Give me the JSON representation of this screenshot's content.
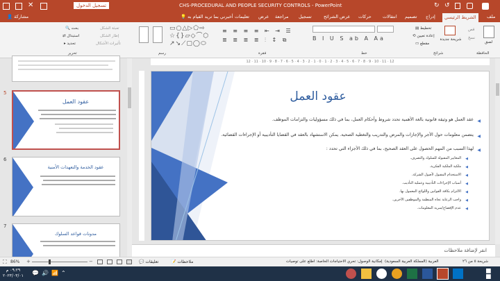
{
  "window": {
    "title": "CHS-PROCEDURAL AND PEOPLE SECURITY CONTROLS  -  PowerPoint",
    "signin": "تسجيل الدخول",
    "share": "مشاركة",
    "tell_me": "أخبرني بما تريد القيام به"
  },
  "tabs": [
    "ملف",
    "الشريط الرئيسي",
    "إدراج",
    "تصميم",
    "انتقالات",
    "حركات",
    "عرض الشرائح",
    "تسجيل",
    "مراجعة",
    "عرض",
    "تعليمات"
  ],
  "ribbon": {
    "paste": "لصق",
    "cut": "قص",
    "copy": "نسخ",
    "new_slide": "شريحة جديدة",
    "layout": "تخطيط",
    "reset": "إعادة تعيين",
    "section": "مقطع",
    "groups": {
      "clipboard": "الحافظة",
      "slides": "شرائح",
      "font": "خط",
      "paragraph": "فقرة",
      "drawing": "رسم",
      "editing": "تحرير"
    },
    "find": "بحث",
    "replace": "استبدال",
    "select": "تحديد",
    "fill": "تعبئة الشكل",
    "outline": "إطار الشكل",
    "effects": "تأثيرات الأشكال"
  },
  "thumbs": [
    {
      "num": "5",
      "title": "عقود العمل"
    },
    {
      "num": "6",
      "title": "عقود الخدمة والتعهدات الأمنية"
    },
    {
      "num": "7",
      "title": "مدونات قواعد السلوك"
    }
  ],
  "slide": {
    "title": "عقود العمل",
    "bullets": [
      "عقد العمل هو وثيقة قانونية بالغة الأهمية تحدد شروط وأحكام العمل، بما في ذلك مسؤوليات والتزامات الموظف.",
      "يتضمن معلومات حول الأجر والإجازات والمرض والتدريب والتغطية الصحية. يمكن الاستشهاد بالعقد في القضايا التأديبية أو الإجراءات القضائية.",
      "لهذا السبب من المهم الحصول على العقد الصحيح، بما في ذلك الأجزاء التي تحدد :"
    ],
    "subs": [
      "المعايير المقبولة للسلوك والتصرف.",
      "ملكية الملكية الفكرية.",
      "الاستخدام المقبول لأصول الشركة.",
      "أسباب الإجراءات التأديبية وعملية التأديب.",
      "الالتزام بكافة القوانين واللوائح المعمول بها.",
      "واجب الرعاية تجاه المنظمة والموظفين الآخرين.",
      "عدم الإفصاح/سرية المعلومات."
    ]
  },
  "ruler_top": "12 · 11 · 10 · 9 · 8 · 7 · 6 · 5 · 4 · 3 · 2 · 1 · 0 · 1 · 2 · 3 · 4 · 5 · 6 · 7 · 8 · 9 · 10 · 11 · 12",
  "notes_placeholder": "انقر لإضافة ملاحظات",
  "status": {
    "slide_info": "شريحة ٥ من ٢٦",
    "language": "العربية (المملكة العربية السعودية)",
    "accessibility": "إمكانية الوصول: تحري الاحتياجات الخاصة: اطلع على توصيات",
    "notes": "ملاحظات",
    "comments": "تعليقات",
    "zoom": "86%"
  },
  "taskbar": {
    "time": "٠٩:٢٩ م",
    "date": "٢٠٢٣/٠٣/٠١"
  },
  "colors": {
    "accent": "#b7472a",
    "title_blue": "#2e5c9e",
    "slide_blue": "#4472c4"
  }
}
